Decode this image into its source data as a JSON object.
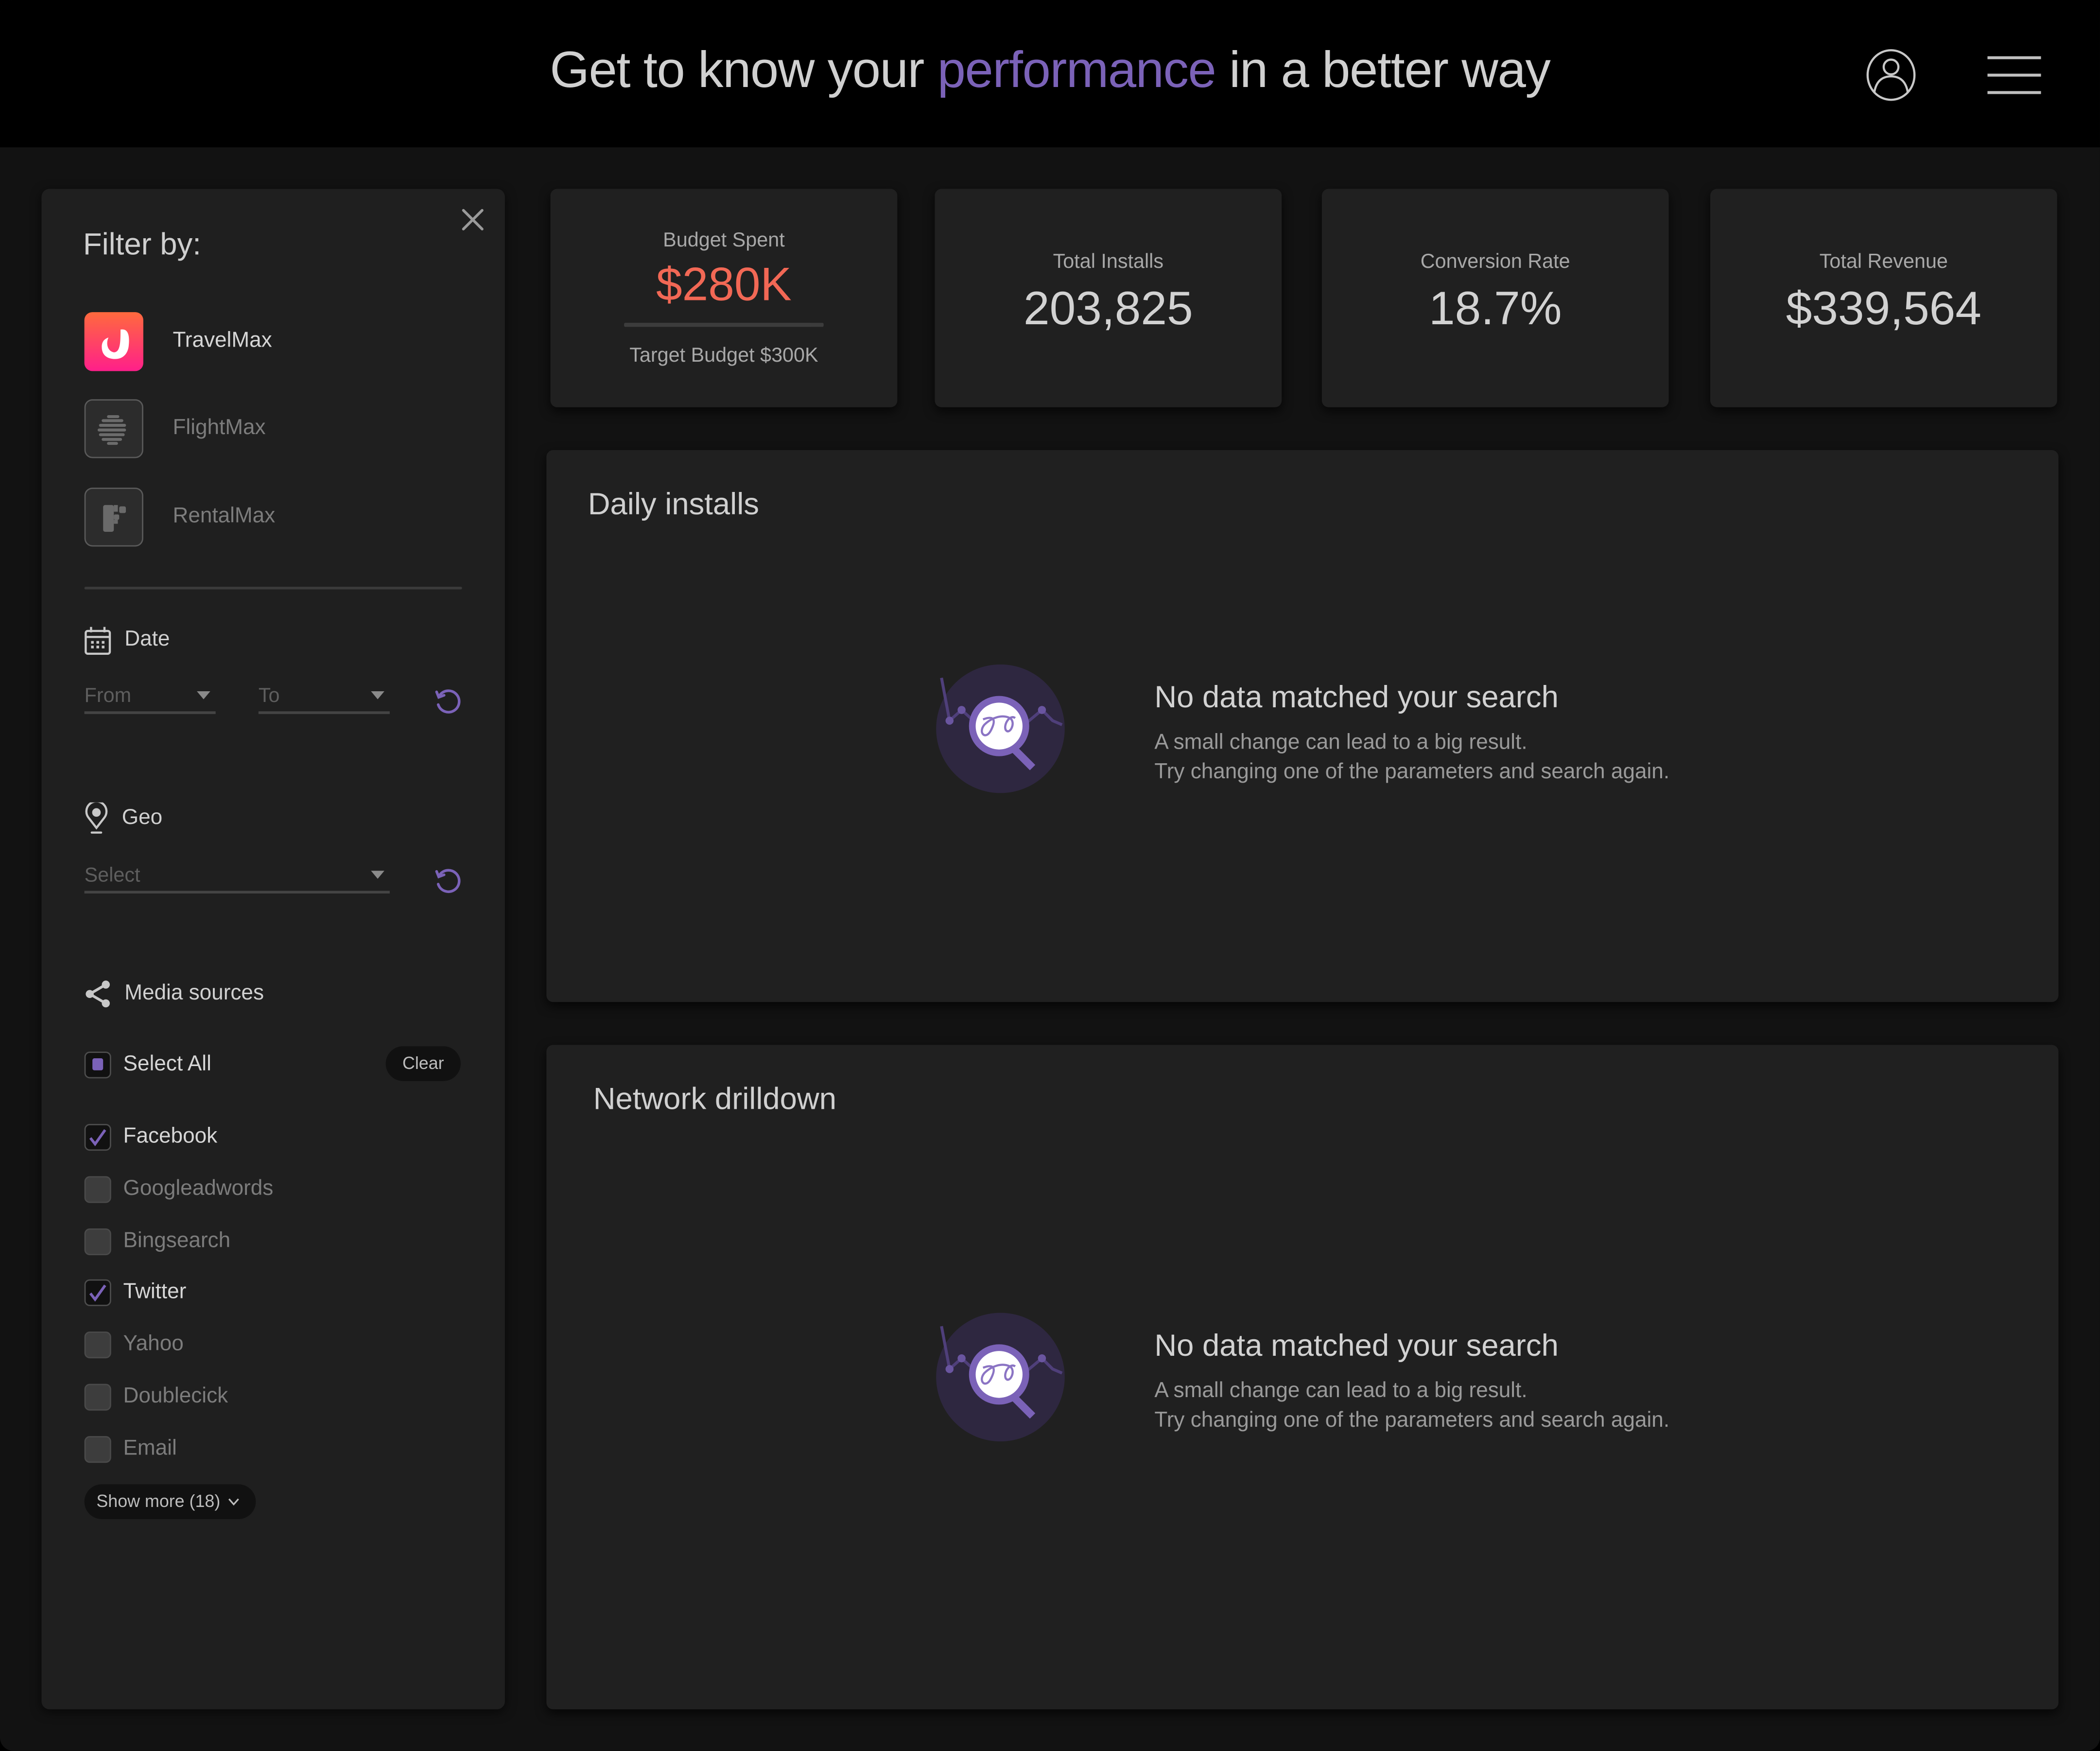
{
  "header": {
    "title_before": "Get to know your ",
    "title_accent": "performance",
    "title_after": " in a better way",
    "accent_color": "#7b62b8",
    "user_icon": "user-circle-icon",
    "menu_icon": "hamburger-menu-icon"
  },
  "sidebar": {
    "title": "Filter by:",
    "close_icon": "close-icon",
    "apps": [
      {
        "label": "TravelMax",
        "selected": true,
        "icon": "travelmax-logo-icon"
      },
      {
        "label": "FlightMax",
        "selected": false,
        "icon": "flightmax-logo-icon"
      },
      {
        "label": "RentalMax",
        "selected": false,
        "icon": "rentalmax-logo-icon"
      }
    ],
    "date": {
      "label": "Date",
      "icon": "calendar-icon",
      "from_placeholder": "From",
      "to_placeholder": "To",
      "reset_icon": "reset-icon"
    },
    "geo": {
      "label": "Geo",
      "icon": "location-pin-icon",
      "placeholder": "Select",
      "reset_icon": "reset-icon"
    },
    "media_sources": {
      "label": "Media sources",
      "icon": "share-icon",
      "select_all_label": "Select All",
      "select_all_state": "indeterminate",
      "clear_label": "Clear",
      "items": [
        {
          "label": "Facebook",
          "checked": true
        },
        {
          "label": "Googleadwords",
          "checked": false
        },
        {
          "label": "Bingsearch",
          "checked": false
        },
        {
          "label": "Twitter",
          "checked": true
        },
        {
          "label": "Yahoo",
          "checked": false
        },
        {
          "label": "Doublecick",
          "checked": false
        },
        {
          "label": "Email",
          "checked": false
        }
      ],
      "show_more_label": "Show more (18)"
    }
  },
  "kpis": [
    {
      "label": "Budget Spent",
      "value": "$280K",
      "sub": "Target Budget $300K",
      "progress": 0.933,
      "value_color": "#f26855"
    },
    {
      "label": "Total Installs",
      "value": "203,825"
    },
    {
      "label": "Conversion Rate",
      "value": "18.7%"
    },
    {
      "label": "Total Revenue",
      "value": "$339,564"
    }
  ],
  "panels": [
    {
      "title": "Daily installs",
      "empty_title": "No data matched your search",
      "empty_line1": "A small change can lead to a big result.",
      "empty_line2": "Try changing one of the parameters and search again.",
      "illustration": "no-data-search-icon"
    },
    {
      "title": "Network drilldown",
      "empty_title": "No data matched your search",
      "empty_line1": "A small change can lead to a big result.",
      "empty_line2": "Try changing one of the parameters and search again.",
      "illustration": "no-data-search-icon"
    }
  ]
}
